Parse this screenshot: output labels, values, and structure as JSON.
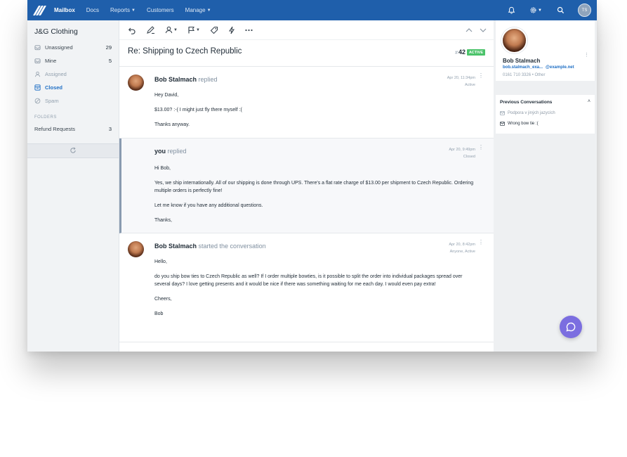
{
  "nav": {
    "items": [
      {
        "label": "Mailbox",
        "active": true,
        "dropdown": false
      },
      {
        "label": "Docs",
        "active": false,
        "dropdown": false
      },
      {
        "label": "Reports",
        "active": false,
        "dropdown": true
      },
      {
        "label": "Customers",
        "active": false,
        "dropdown": false
      },
      {
        "label": "Manage",
        "active": false,
        "dropdown": true
      }
    ],
    "right_icons": [
      "bell-icon",
      "gear-icon",
      "search-icon"
    ],
    "user_initials": "TS",
    "bar_color": "#1f5fab"
  },
  "sidebar": {
    "mailbox_name": "J&G Clothing",
    "items": [
      {
        "label": "Unassigned",
        "count": "29",
        "icon": "unassigned-icon",
        "state": "normal"
      },
      {
        "label": "Mine",
        "count": "5",
        "icon": "mine-icon",
        "state": "normal"
      },
      {
        "label": "Assigned",
        "count": "",
        "icon": "assigned-icon",
        "state": "muted"
      },
      {
        "label": "Closed",
        "count": "",
        "icon": "closed-icon",
        "state": "active"
      },
      {
        "label": "Spam",
        "count": "",
        "icon": "spam-icon",
        "state": "muted"
      }
    ],
    "folders_label": "FOLDERS",
    "folders": [
      {
        "label": "Refund Requests",
        "count": "3"
      }
    ]
  },
  "toolbar": {
    "icons": [
      "undo-icon",
      "edit-icon",
      "assign-icon",
      "flag-icon",
      "tag-icon",
      "workflow-icon",
      "more-icon"
    ],
    "nav_icons": [
      "chevron-up-icon",
      "chevron-down-icon"
    ]
  },
  "conversation": {
    "subject": "Re: Shipping to Czech Republic",
    "number_hash": "#",
    "number": "42",
    "status": "ACTIVE",
    "status_color": "#4bc36a"
  },
  "threads": [
    {
      "author": "Bob Stalmach",
      "verb": "replied",
      "date": "Apr 20, 11:34pm",
      "status": "Active",
      "note": false,
      "body": [
        "Hey David,",
        "$13.00? :-( I might just fly there myself :(",
        "Thanks anyway."
      ]
    },
    {
      "author": "you",
      "verb": "replied",
      "date": "Apr 20, 9:49pm",
      "status": "Closed",
      "note": true,
      "body": [
        "Hi Bob,",
        "Yes, we ship internationally. All of our shipping is done through UPS. There's a flat rate charge of $13.00 per shipment to Czech Republic. Ordering multiple orders is perfectly fine!",
        "Let me know if you have any additional questions.",
        "Thanks,"
      ]
    },
    {
      "author": "Bob Stalmach",
      "verb": "started the conversation",
      "date": "Apr 20, 8:42pm",
      "status": "Anyone, Active",
      "note": false,
      "body": [
        "Hello,",
        "do you ship bow ties to Czech Republic as well? If I order multiple bowties, is it possible to split the order into individual packages spread over several days? I love getting presents and it would be nice if there was something waiting for me each day. I would even pay extra!",
        "Cheers,",
        "Bob"
      ]
    }
  ],
  "customer": {
    "name": "Bob Stalmach",
    "email_user": "bob.stalmach_exa...",
    "email_domain": "@example.net",
    "phone": "0161 710 3326",
    "phone_sep": "•",
    "phone_type": "Other"
  },
  "previous": {
    "title": "Previous Conversations",
    "items": [
      {
        "label": "Podpora v jiných jazycích",
        "muted": true
      },
      {
        "label": "Wrong bow tie :(",
        "muted": false
      }
    ]
  },
  "beacon": {
    "icon": "chat-bubble-icon",
    "color": "#7b6ee0"
  }
}
